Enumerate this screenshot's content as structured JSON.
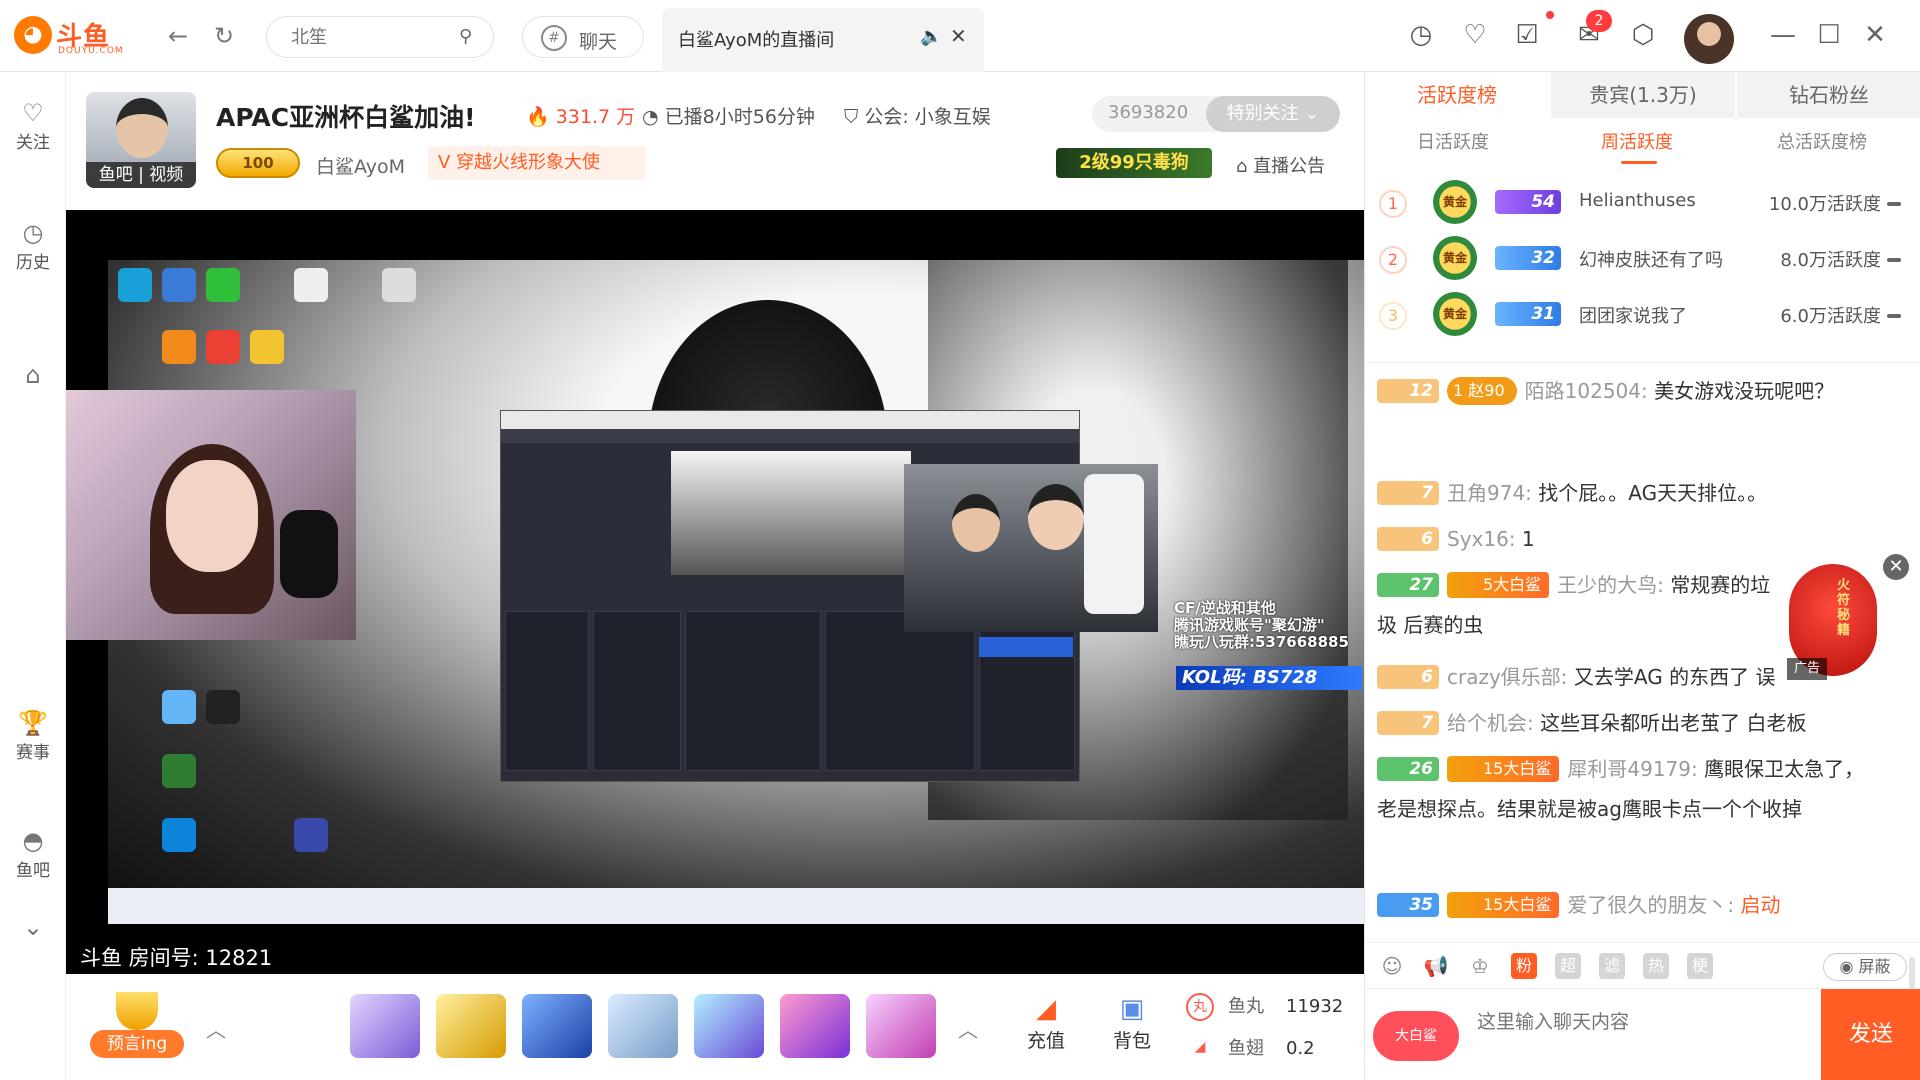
{
  "topbar": {
    "logo_text": "斗鱼",
    "logo_sub": "DOUYU.COM",
    "search_placeholder": "北笙",
    "chat_label": "聊天",
    "tab_title": "白鲨AyoM的直播间",
    "message_badge": "2"
  },
  "rail": [
    {
      "name": "follow",
      "label": "关注",
      "icon": "♡"
    },
    {
      "name": "history",
      "label": "历史",
      "icon": "◷"
    },
    {
      "name": "events",
      "label": "赛事",
      "icon": "🏆"
    },
    {
      "name": "fishbar",
      "label": "鱼吧",
      "icon": "◓"
    }
  ],
  "room": {
    "avatar_label": "鱼吧 | 视频",
    "title": "APAC亚洲杯白鲨加油!",
    "heat": "331.7 万",
    "live_time": "已播8小时56分钟",
    "guild": "公会: 小象互娱",
    "fans_count": "3693820",
    "follow_label": "特别关注",
    "level": "100",
    "host_name": "白鲨AyoM",
    "ambassador_tag": "穿越火线形象大使",
    "promo": "2级99只毒狗",
    "announcement": "直播公告"
  },
  "video": {
    "overlay_lines": [
      "CF/逆战和其他",
      "腾讯游戏账号\"聚幻游\"",
      "瞧玩八玩群:537668885"
    ],
    "kol": "KOL码: BS728",
    "room_number": "斗鱼 房间号:  12821"
  },
  "bottombar": {
    "predict_label": "预言ing",
    "recharge_label": "充值",
    "backpack_label": "背包",
    "fish_ball_label": "鱼丸",
    "fish_ball_value": "11932",
    "fish_fin_label": "鱼翅",
    "fish_fin_value": "0.2"
  },
  "panel": {
    "tabs": [
      "活跃度榜",
      "贵宾(1.3万)",
      "钻石粉丝"
    ],
    "subtabs": [
      "日活跃度",
      "周活跃度",
      "总活跃度榜"
    ],
    "ranks": [
      {
        "no": "1",
        "medal": "黄金",
        "level": "54",
        "name": "Helianthuses",
        "score": "10.0万活跃度"
      },
      {
        "no": "2",
        "medal": "黄金",
        "level": "32",
        "name": "幻神皮肤还有了吗",
        "score": "8.0万活跃度"
      },
      {
        "no": "3",
        "medal": "黄金",
        "level": "31",
        "name": "团团家说我了",
        "score": "6.0万活跃度"
      }
    ],
    "messages": [
      {
        "level": "12",
        "fan": "赵90",
        "fan_level": "1",
        "nick": "陌路102504:",
        "text": " 美女游戏没玩呢吧？"
      },
      {
        "level": "7",
        "nick": "丑角974:",
        "text": " 找个屁。。AG天天排位。。"
      },
      {
        "level": "6",
        "nick": "Syx16:",
        "text": " 1"
      },
      {
        "level": "27",
        "shark": "5大白鲨",
        "nick": "王少的大鸟:",
        "text": " 常规赛的垃圾 后赛的虫"
      },
      {
        "level": "6",
        "nick": "crazy俱乐部:",
        "text": " 又去学AG 的东西了 误"
      },
      {
        "level": "7",
        "nick": "给个机会:",
        "text": " 这些耳朵都听出老茧了 白老板"
      },
      {
        "level": "26",
        "shark": "15大白鲨",
        "nick": "犀利哥49179:",
        "text": " 鹰眼保卫太急了，老是想探点。结果就是被ag鹰眼卡点一个个收掉"
      },
      {
        "level": "35",
        "shark": "15大白鲨",
        "nick": "爱了很久的朋友丶:",
        "text": " ",
        "highlight": "启动"
      }
    ],
    "ad_label": "广告",
    "ad_text": "火符秘籍",
    "tools": [
      "粉",
      "超",
      "滤",
      "热",
      "梗"
    ],
    "block_label": "屏蔽",
    "fan_badge": "大白鲨",
    "input_placeholder": "这里输入聊天内容",
    "send_label": "发送"
  }
}
